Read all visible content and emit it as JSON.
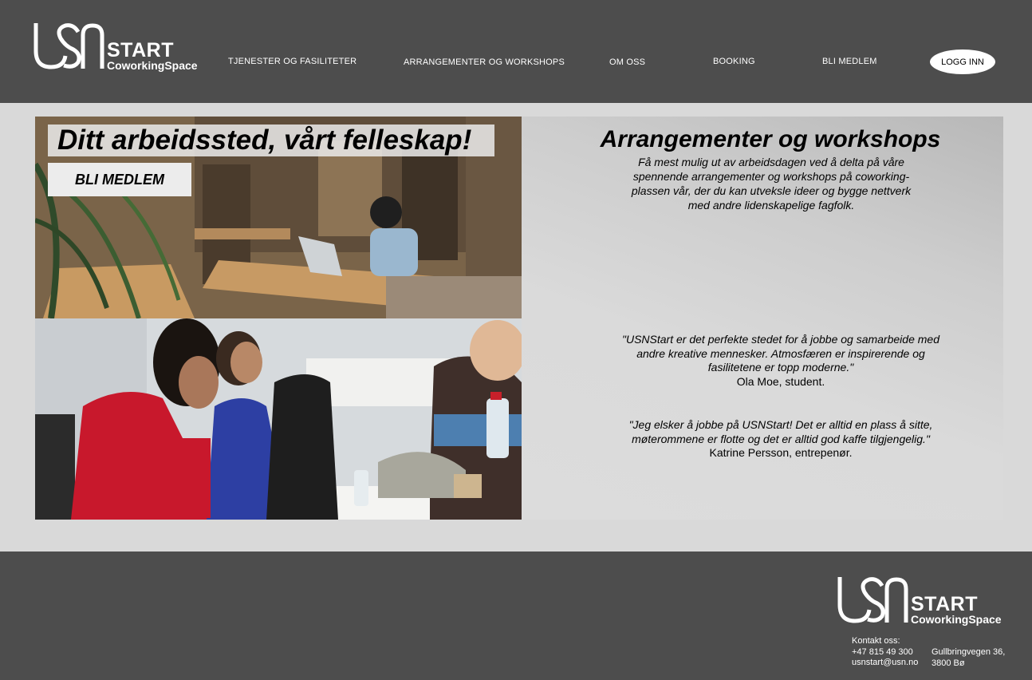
{
  "brand": {
    "mark": "USN",
    "start": "START",
    "subtitle": "CoworkingSpace"
  },
  "nav": {
    "items": [
      {
        "label": "TJENESTER OG FASILITETER"
      },
      {
        "label": "ARRANGEMENTER OG WORKSHOPS"
      },
      {
        "label": "OM OSS"
      },
      {
        "label": "BOOKING"
      },
      {
        "label": "BLI MEDLEM"
      }
    ],
    "login_label": "LOGG INN"
  },
  "hero": {
    "title": "Ditt arbeidssted, vårt felleskap!",
    "button_label": "BLI MEDLEM"
  },
  "events": {
    "title": "Arrangementer og workshops",
    "text": "Få mest mulig ut av arbeidsdagen ved å delta på våre spennende arrangementer og workshops på coworking-plassen vår, der du kan utveksle ideer og bygge nettverk med andre lidenskapelige fagfolk."
  },
  "quotes": [
    {
      "text": "\"USNStart er det perfekte stedet for å jobbe og samarbeide med andre kreative mennesker. Atmosfæren er inspirerende og fasilitetene er topp moderne.\"",
      "author": "Ola Moe, student."
    },
    {
      "text": "\"Jeg elsker å jobbe på USNStart! Det er alltid en plass å sitte, møterommene er flotte og det er alltid god kaffe tilgjengelig.\"",
      "author": "Katrine Persson, entrepenør."
    }
  ],
  "footer": {
    "contact_label": "Kontakt oss:",
    "phone": "+47 815 49 300",
    "email": "usnstart@usn.no",
    "address_line1": "Gullbringvegen 36,",
    "address_line2": "3800 Bø"
  }
}
